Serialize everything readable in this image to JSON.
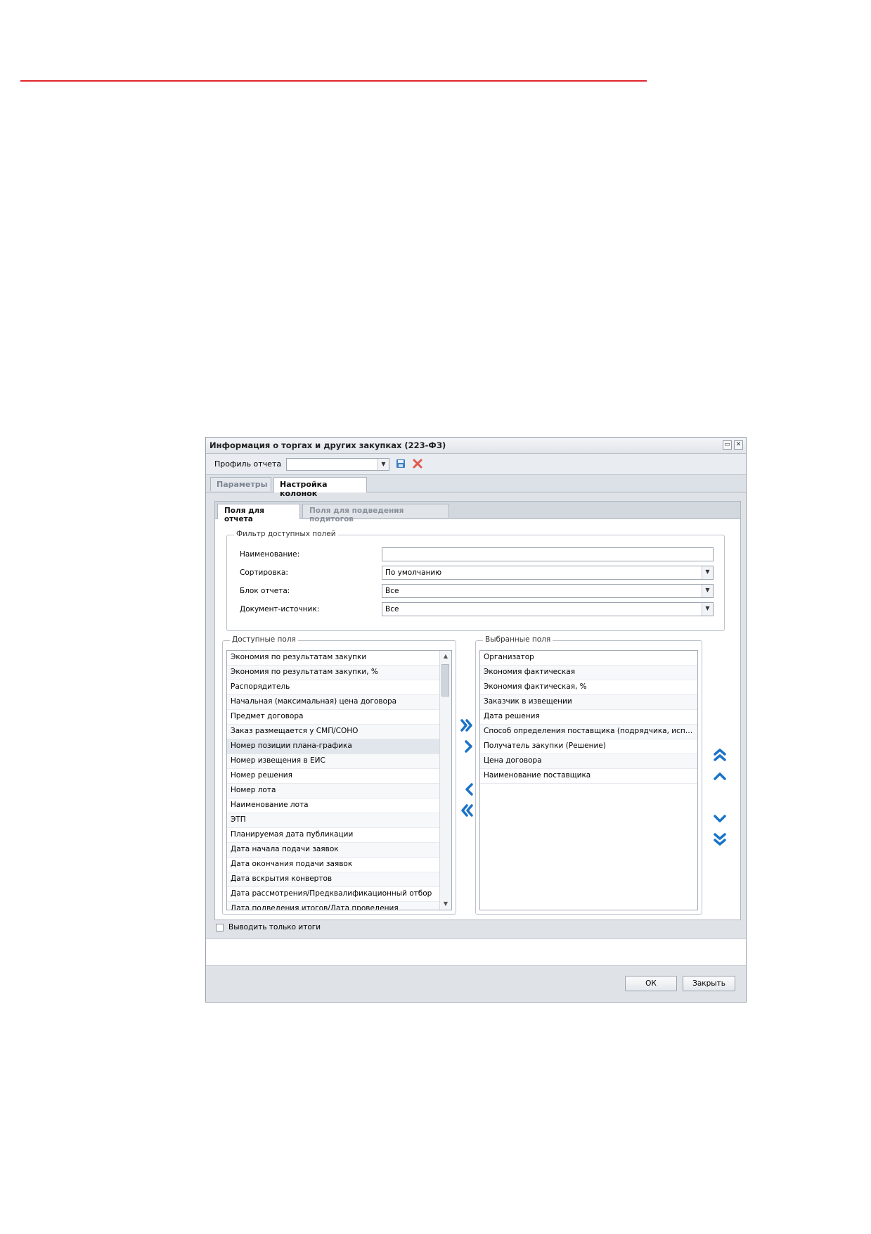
{
  "dialog": {
    "title": "Информация о торгах и других закупках (223-ФЗ)",
    "minimize_glyph": "▭",
    "close_glyph": "✕"
  },
  "profile": {
    "label": "Профиль отчета",
    "value": "",
    "arrow": "▼"
  },
  "outer_tabs": [
    {
      "label": "Параметры",
      "active": false
    },
    {
      "label": "Настройка колонок",
      "active": true
    }
  ],
  "inner_tabs": [
    {
      "label": "Поля для отчета",
      "active": true
    },
    {
      "label": "Поля для подведения подитогов",
      "active": false
    }
  ],
  "filter": {
    "legend": "Фильтр доступных полей",
    "fields": [
      {
        "label": "Наименование:",
        "value": "",
        "dropdown": false
      },
      {
        "label": "Сортировка:",
        "value": "По умолчанию",
        "dropdown": true
      },
      {
        "label": "Блок отчета:",
        "value": "Все",
        "dropdown": true
      },
      {
        "label": "Документ-источник:",
        "value": "Все",
        "dropdown": true
      }
    ]
  },
  "available": {
    "legend": "Доступные поля",
    "items": [
      "Экономия по результатам закупки",
      "Экономия по результатам закупки, %",
      "Распорядитель",
      "Начальная (максимальная) цена договора",
      "Предмет договора",
      "Заказ размещается у СМП/СОНО",
      "Номер позиции плана-графика",
      "Номер извещения в ЕИС",
      "Номер решения",
      "Номер лота",
      "Наименование лота",
      "ЭТП",
      "Планируемая дата публикации",
      "Дата начала подачи заявок",
      "Дата окончания подачи заявок",
      "Дата вскрытия конвертов",
      "Дата рассмотрения/Предквалификационный отбор",
      "Дата подведения итогов/Дата проведения"
    ],
    "selected_index": 6
  },
  "selected": {
    "legend": "Выбранные поля",
    "items": [
      "Организатор",
      "Экономия фактическая",
      "Экономия фактическая, %",
      "Заказчик в извещении",
      "Дата решения",
      "Способ определения поставщика (подрядчика, исполн…",
      "Получатель закупки (Решение)",
      "Цена договора",
      "Наименование поставщика"
    ]
  },
  "colors": {
    "accent_arrow": "#1a73c9",
    "rule": "#e0262b"
  },
  "only_totals": {
    "label": "Выводить только итоги",
    "checked": false
  },
  "buttons": {
    "ok": "ОК",
    "close": "Закрыть"
  },
  "scroll_up": "▲",
  "scroll_down": "▼"
}
